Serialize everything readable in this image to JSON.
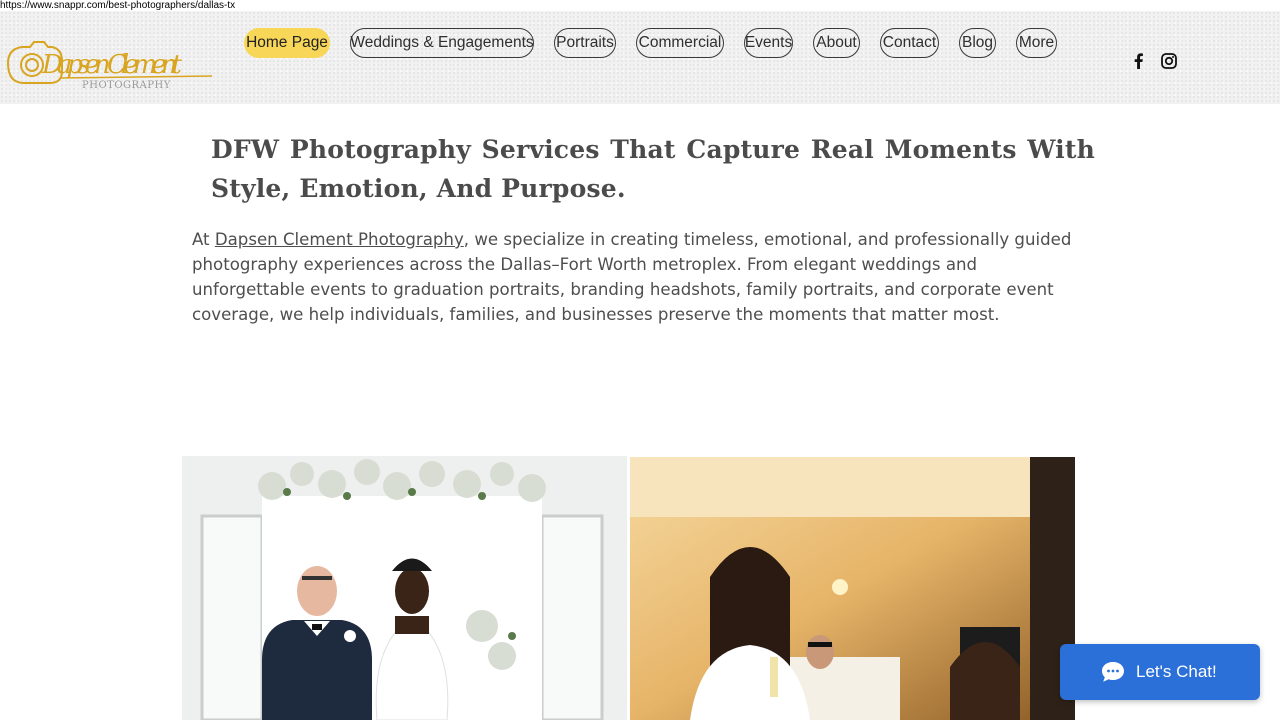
{
  "browser": {
    "url": "https://www.snappr.com/best-photographers/dallas-tx"
  },
  "brand": {
    "name_script": "Dapsen Clement",
    "name_sub": "PHOTOGRAPHY",
    "accent": "#d9a520"
  },
  "nav": {
    "items": [
      {
        "label": "Home Page",
        "active": true
      },
      {
        "label": "Weddings & Engagements"
      },
      {
        "label": "Portraits"
      },
      {
        "label": "Commercial"
      },
      {
        "label": "Events"
      },
      {
        "label": "About"
      },
      {
        "label": "Contact"
      },
      {
        "label": "Blog"
      },
      {
        "label": "More"
      }
    ]
  },
  "social": {
    "icons": [
      "facebook-icon",
      "instagram-icon"
    ]
  },
  "main": {
    "headline": "DFW Photography Services That Capture Real Moments With Style, Emotion, And Purpose.",
    "intro_prefix": "At ",
    "intro_link": "Dapsen Clement Photography",
    "intro_rest": ", we specialize in creating timeless, emotional, and professionally guided photography experiences across the Dallas–Fort Worth metroplex. From elegant weddings and unforgettable events to graduation portraits, branding headshots, family portraits, and corporate event coverage, we help individuals, families, and businesses preserve the moments that matter most."
  },
  "chat": {
    "label": "Let's Chat!",
    "color": "#2b6fd8"
  }
}
